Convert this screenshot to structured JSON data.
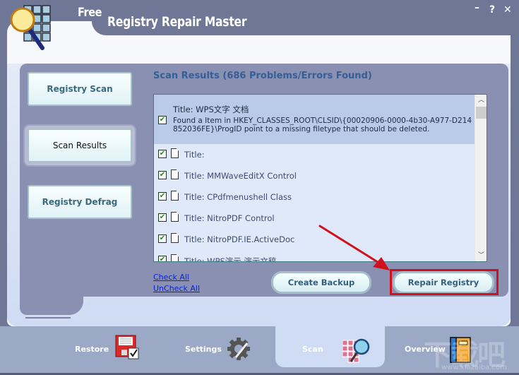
{
  "app": {
    "title_free": "Free",
    "title_main": "Registry Repair Master",
    "window_controls": {
      "minimize": "–",
      "help": "?",
      "close": "✕"
    }
  },
  "sidebar": {
    "items": [
      {
        "label": "Registry Scan",
        "active": false
      },
      {
        "label": "Scan Results",
        "active": true
      },
      {
        "label": "Registry Defrag",
        "active": false
      }
    ]
  },
  "results": {
    "heading": "Scan Results (686 Problems/Errors Found)",
    "selected_item": {
      "title": "Title: WPS文字 文档",
      "description": "Found a Item in HKEY_CLASSES_ROOT\\CLSID\\{00020906-0000-4b30-A977-D214852036FE}\\ProgID point to a missing filetype that should be deleted.",
      "checked": true
    },
    "items": [
      {
        "title": "Title:",
        "checked": true
      },
      {
        "title": "Title: MMWaveEditX Control",
        "checked": true
      },
      {
        "title": "Title: CPdfmenushell Class",
        "checked": true
      },
      {
        "title": "Title: NitroPDF Control",
        "checked": true
      },
      {
        "title": "Title: NitroPDF.IE.ActiveDoc",
        "checked": true
      },
      {
        "title": "Title: WPS演示 演示文稿",
        "checked": true
      }
    ],
    "check_all": "Check All",
    "uncheck_all": "UnCheck All",
    "create_backup": "Create Backup",
    "repair_registry": "Repair Registry"
  },
  "tabs": [
    {
      "label": "Restore",
      "icon": "floppy-disk-icon",
      "active": false
    },
    {
      "label": "Settings",
      "icon": "gear-icon",
      "active": false
    },
    {
      "label": "Scan",
      "icon": "grid-magnifier-icon",
      "active": true
    },
    {
      "label": "Overview",
      "icon": "book-icon",
      "active": false
    }
  ],
  "colors": {
    "accent_blue": "#355e94",
    "highlight_red": "#d0111b",
    "title_bar": "#6f7796",
    "content_panel": "#8a90b2"
  },
  "watermark": {
    "text": "下载吧",
    "url": "www.xiazaiba.com"
  }
}
